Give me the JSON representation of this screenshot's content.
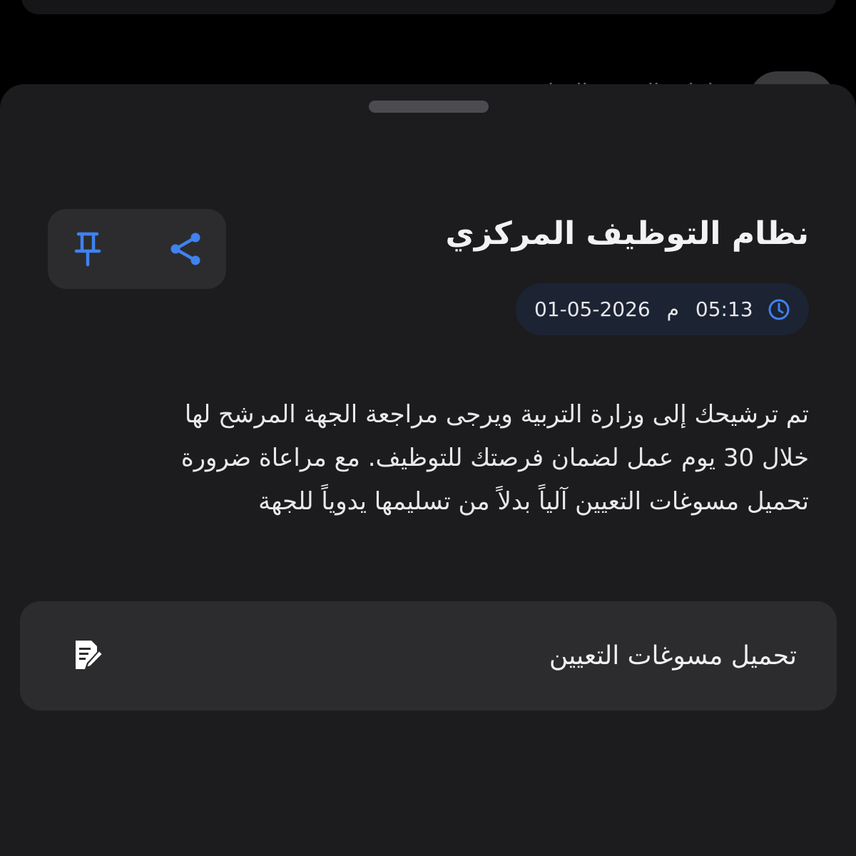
{
  "background": {
    "peek_text": "إعلان الفرصة الوظيفية"
  },
  "notification": {
    "title": "نظام التوظيف المركزي",
    "timestamp": {
      "time": "05:13",
      "period": "م",
      "date": "01-05-2026"
    },
    "body_lines": [
      "تم ترشيحك إلى وزارة التربية ويرجى مراجعة الجهة المرشح لها",
      "خلال 30 يوم عمل لضمان فرصتك للتوظيف. مع مراعاة ضرورة",
      "تحميل مسوغات التعيين آلياً بدلاً من تسليمها يدوياً للجهة"
    ],
    "actions": {
      "pin_icon": "pin-icon",
      "share_icon": "share-icon"
    },
    "document_action": {
      "label": "تحميل مسوغات التعيين",
      "icon": "document-edit-icon"
    }
  },
  "colors": {
    "accent": "#3f82f0",
    "sheet_background": "#1c1c1e",
    "card_background": "#2c2c2e",
    "time_chip_background": "#1c2333"
  }
}
